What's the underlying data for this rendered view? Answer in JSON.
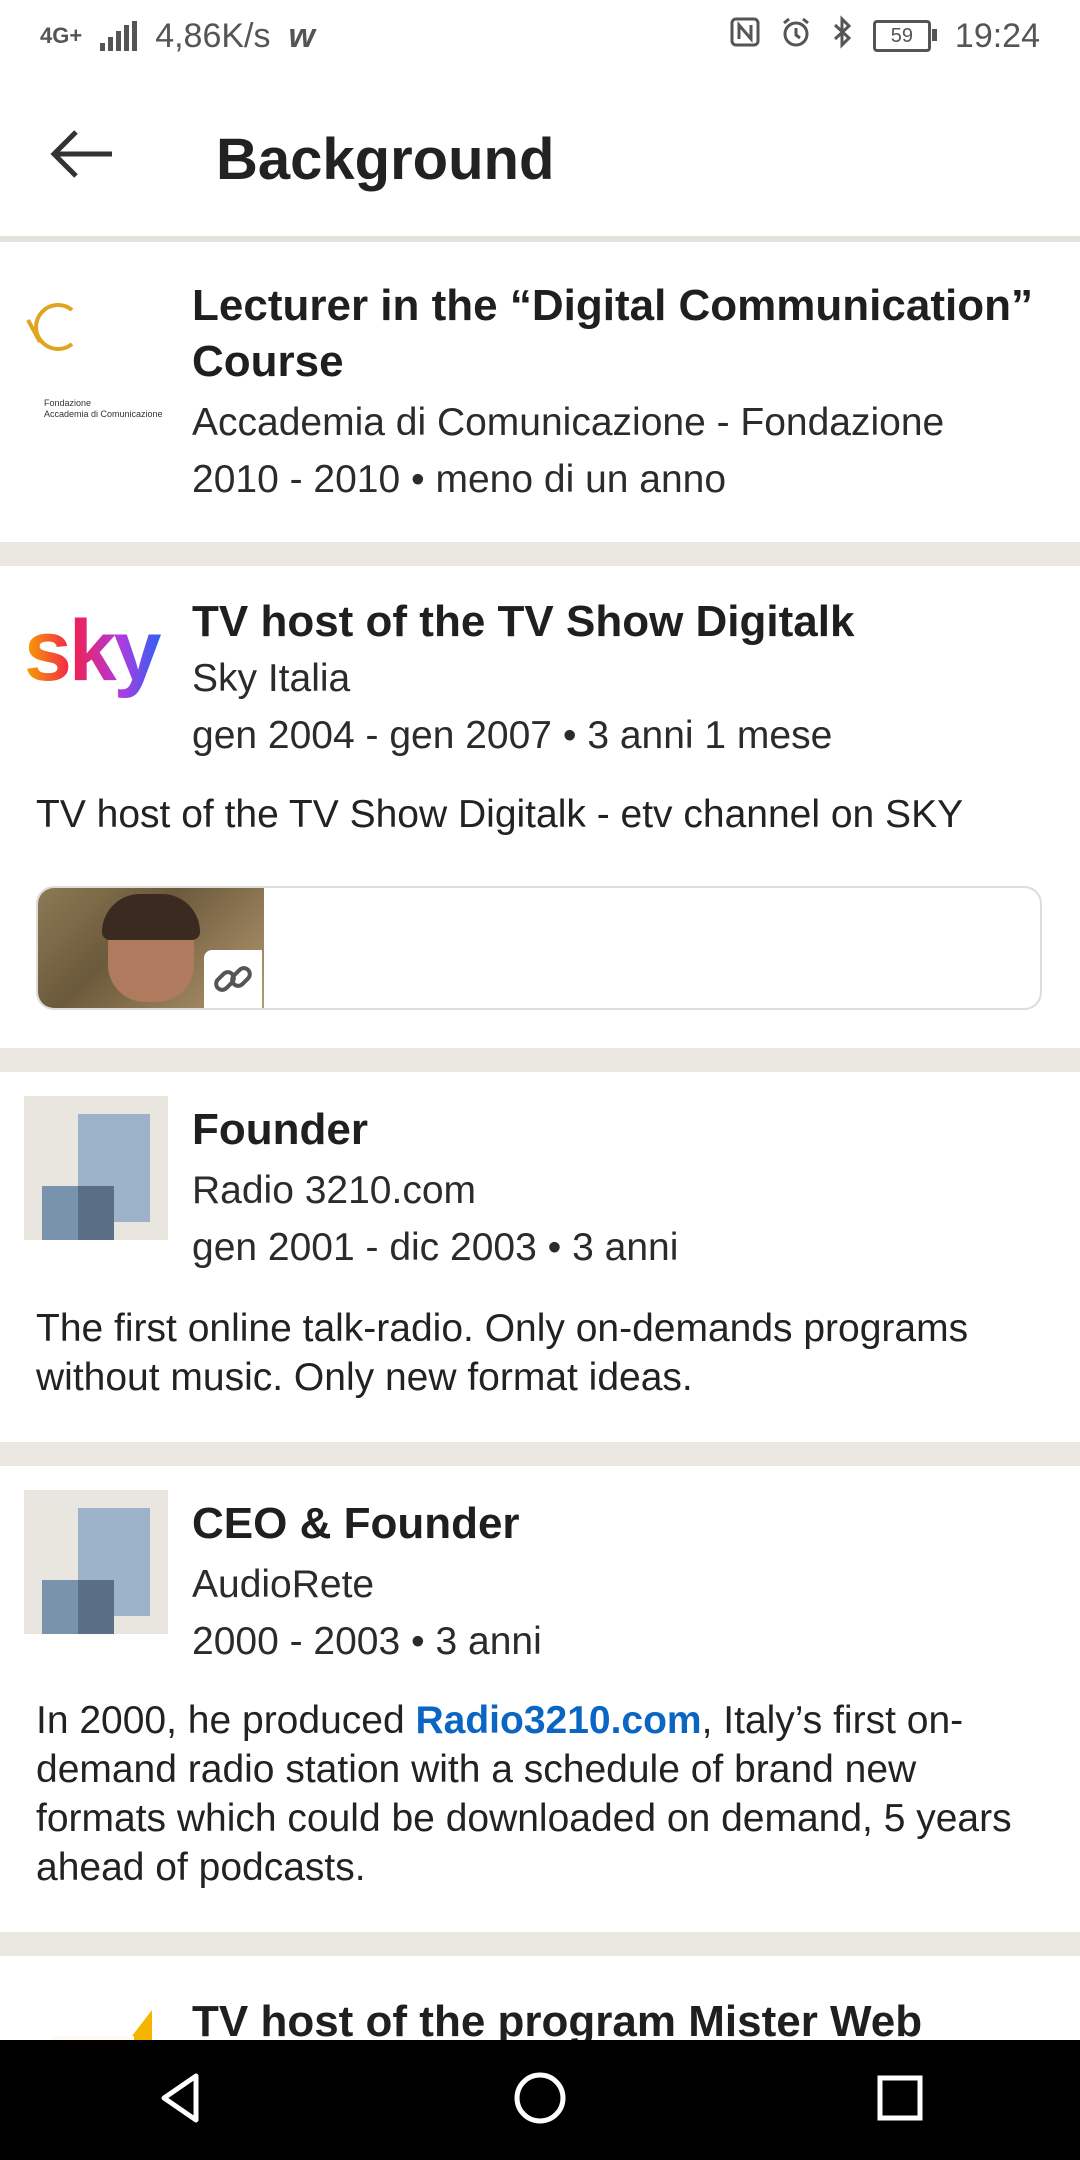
{
  "status_bar": {
    "network": "4G+",
    "speed": "4,86K/s",
    "battery": "59",
    "time": "19:24"
  },
  "header": {
    "title": "Background"
  },
  "experiences": [
    {
      "title": "Lecturer in the “Digital Communication” Course",
      "company": "Accademia di Comunicazione - Fondazione",
      "dates": "2010 - 2010 • meno di un anno",
      "logo_caption_1": "Fondazione",
      "logo_caption_2": "Accademia di Comunicazione"
    },
    {
      "title": "TV host of the TV Show Digitalk",
      "company": "Sky Italia",
      "dates": "gen 2004 - gen 2007 • 3 anni 1 mese",
      "description": "TV host of the TV Show Digitalk - etv channel on SKY",
      "logo_text": "sky"
    },
    {
      "title": "Founder",
      "company": "Radio 3210.com",
      "dates": "gen 2001 - dic 2003 • 3 anni",
      "description": "The first online talk-radio. Only on-demands programs without music. Only new format ideas."
    },
    {
      "title": "CEO & Founder",
      "company": "AudioRete",
      "dates": "2000 - 2003 • 3 anni",
      "description_before": "In 2000, he produced ",
      "description_link": "Radio3210.com",
      "description_after": ", Italy’s first on-demand radio station with a schedule of brand new formats which could be downloaded on demand, 5 years ahead of podcasts."
    },
    {
      "title": "TV host of the program Mister Web"
    }
  ],
  "icons": {
    "back": "arrow-left-icon",
    "nav": [
      "back-triangle-icon",
      "home-circle-icon",
      "recents-square-icon"
    ]
  },
  "colors": {
    "link": "#0a66c2",
    "divider": "#eae7e1",
    "placeholder_logo_bg": "#e9e6df",
    "placeholder_logo_fg": "#9db3c9"
  }
}
